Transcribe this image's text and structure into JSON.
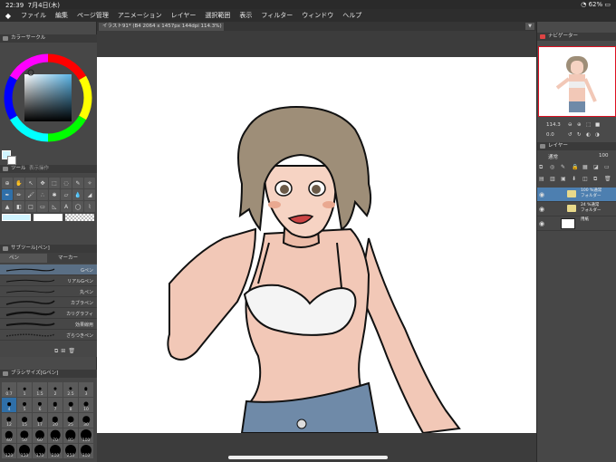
{
  "status": {
    "time": "22:39",
    "date": "7月4日(木)",
    "battery": "62%"
  },
  "menu": [
    "ファイル",
    "編集",
    "ページ管理",
    "アニメーション",
    "レイヤー",
    "選択範囲",
    "表示",
    "フィルター",
    "ウィンドウ",
    "ヘルプ"
  ],
  "tab": {
    "title": "イラスト91* (B4 2064 x 1457px 144dpi 114.3%)"
  },
  "color_panel": {
    "title": "カラーサークル",
    "r": "208",
    "g": "244",
    "b": "255"
  },
  "tool_panel": {
    "title": "ツール",
    "subtitle": "表示操作"
  },
  "subtool": {
    "title": "サブツール[ペン]",
    "tabs": [
      "ペン",
      "マーカー"
    ],
    "brushes": [
      "Gペン",
      "リアルGペン",
      "丸ペン",
      "カブラペン",
      "カリグラフィ",
      "効果線用",
      "ざらつきペン"
    ]
  },
  "brush_size": {
    "title": "ブラシサイズ[Gペン]",
    "sizes": [
      "0.7",
      "1",
      "1.5",
      "2",
      "2.5",
      "3",
      "4",
      "5",
      "6",
      "7",
      "8",
      "10",
      "12",
      "15",
      "17",
      "20",
      "25",
      "30",
      "40",
      "50",
      "60",
      "70",
      "80",
      "100",
      "120",
      "150",
      "170",
      "200",
      "250",
      "300"
    ]
  },
  "navigator": {
    "title": "ナビゲーター",
    "zoom": "114.3",
    "rotation": "0.0"
  },
  "layers": {
    "title": "レイヤー",
    "blend": "通常",
    "opacity": "100",
    "rows": [
      {
        "line1": "100 %通常",
        "line2": "フォルダー"
      },
      {
        "line1": "24 %通常",
        "line2": "フォルダー"
      },
      {
        "line1": "",
        "line2": "用紙"
      }
    ]
  },
  "colors": {
    "accent": "#2f6fa8",
    "panel": "#474747",
    "canvas_bg": "#3c3c3c"
  }
}
